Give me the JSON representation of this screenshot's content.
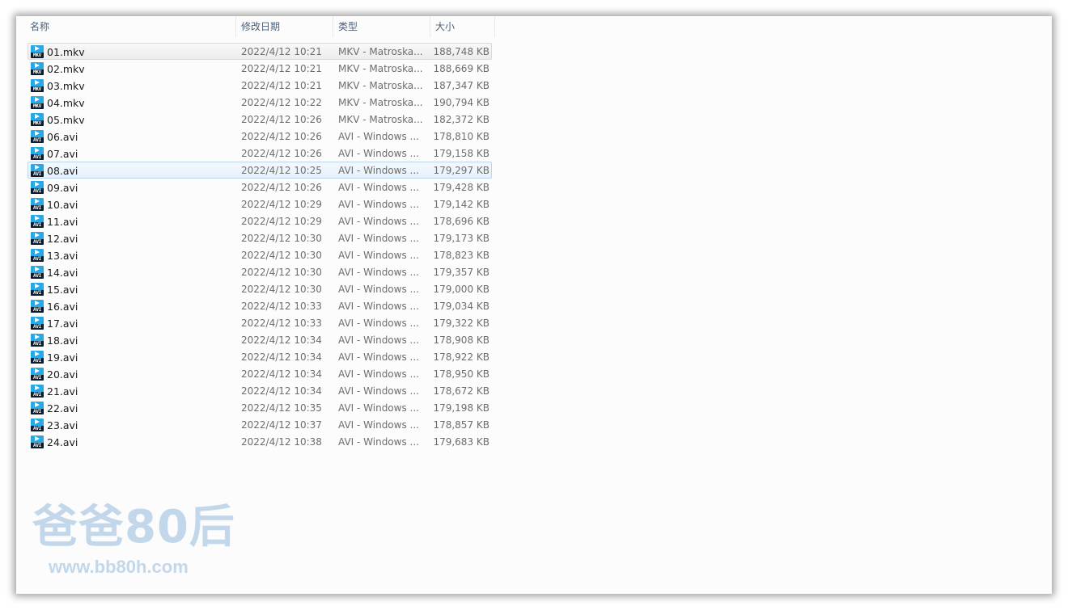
{
  "header": {
    "columns": {
      "name": "名称",
      "date": "修改日期",
      "type": "类型",
      "size": "大小"
    },
    "sort_indicator": "˄"
  },
  "files": [
    {
      "name": "01.mkv",
      "date": "2022/4/12 10:21",
      "type": "MKV - Matroska...",
      "size": "188,748 KB",
      "icon": "mkv-file-icon",
      "tag": "MKV"
    },
    {
      "name": "02.mkv",
      "date": "2022/4/12 10:21",
      "type": "MKV - Matroska...",
      "size": "188,669 KB",
      "icon": "mkv-file-icon",
      "tag": "MKV"
    },
    {
      "name": "03.mkv",
      "date": "2022/4/12 10:21",
      "type": "MKV - Matroska...",
      "size": "187,347 KB",
      "icon": "mkv-file-icon",
      "tag": "MKV"
    },
    {
      "name": "04.mkv",
      "date": "2022/4/12 10:22",
      "type": "MKV - Matroska...",
      "size": "190,794 KB",
      "icon": "mkv-file-icon",
      "tag": "MKV"
    },
    {
      "name": "05.mkv",
      "date": "2022/4/12 10:26",
      "type": "MKV - Matroska...",
      "size": "182,372 KB",
      "icon": "mkv-file-icon",
      "tag": "MKV"
    },
    {
      "name": "06.avi",
      "date": "2022/4/12 10:26",
      "type": "AVI - Windows ...",
      "size": "178,810 KB",
      "icon": "avi-file-icon",
      "tag": "AVI"
    },
    {
      "name": "07.avi",
      "date": "2022/4/12 10:26",
      "type": "AVI - Windows ...",
      "size": "179,158 KB",
      "icon": "avi-file-icon",
      "tag": "AVI"
    },
    {
      "name": "08.avi",
      "date": "2022/4/12 10:25",
      "type": "AVI - Windows ...",
      "size": "179,297 KB",
      "icon": "avi-file-icon",
      "tag": "AVI"
    },
    {
      "name": "09.avi",
      "date": "2022/4/12 10:26",
      "type": "AVI - Windows ...",
      "size": "179,428 KB",
      "icon": "avi-file-icon",
      "tag": "AVI"
    },
    {
      "name": "10.avi",
      "date": "2022/4/12 10:29",
      "type": "AVI - Windows ...",
      "size": "179,142 KB",
      "icon": "avi-file-icon",
      "tag": "AVI"
    },
    {
      "name": "11.avi",
      "date": "2022/4/12 10:29",
      "type": "AVI - Windows ...",
      "size": "178,696 KB",
      "icon": "avi-file-icon",
      "tag": "AVI"
    },
    {
      "name": "12.avi",
      "date": "2022/4/12 10:30",
      "type": "AVI - Windows ...",
      "size": "179,173 KB",
      "icon": "avi-file-icon",
      "tag": "AVI"
    },
    {
      "name": "13.avi",
      "date": "2022/4/12 10:30",
      "type": "AVI - Windows ...",
      "size": "178,823 KB",
      "icon": "avi-file-icon",
      "tag": "AVI"
    },
    {
      "name": "14.avi",
      "date": "2022/4/12 10:30",
      "type": "AVI - Windows ...",
      "size": "179,357 KB",
      "icon": "avi-file-icon",
      "tag": "AVI"
    },
    {
      "name": "15.avi",
      "date": "2022/4/12 10:30",
      "type": "AVI - Windows ...",
      "size": "179,000 KB",
      "icon": "avi-file-icon",
      "tag": "AVI"
    },
    {
      "name": "16.avi",
      "date": "2022/4/12 10:33",
      "type": "AVI - Windows ...",
      "size": "179,034 KB",
      "icon": "avi-file-icon",
      "tag": "AVI"
    },
    {
      "name": "17.avi",
      "date": "2022/4/12 10:33",
      "type": "AVI - Windows ...",
      "size": "179,322 KB",
      "icon": "avi-file-icon",
      "tag": "AVI"
    },
    {
      "name": "18.avi",
      "date": "2022/4/12 10:34",
      "type": "AVI - Windows ...",
      "size": "178,908 KB",
      "icon": "avi-file-icon",
      "tag": "AVI"
    },
    {
      "name": "19.avi",
      "date": "2022/4/12 10:34",
      "type": "AVI - Windows ...",
      "size": "178,922 KB",
      "icon": "avi-file-icon",
      "tag": "AVI"
    },
    {
      "name": "20.avi",
      "date": "2022/4/12 10:34",
      "type": "AVI - Windows ...",
      "size": "178,950 KB",
      "icon": "avi-file-icon",
      "tag": "AVI"
    },
    {
      "name": "21.avi",
      "date": "2022/4/12 10:34",
      "type": "AVI - Windows ...",
      "size": "178,672 KB",
      "icon": "avi-file-icon",
      "tag": "AVI"
    },
    {
      "name": "22.avi",
      "date": "2022/4/12 10:35",
      "type": "AVI - Windows ...",
      "size": "179,198 KB",
      "icon": "avi-file-icon",
      "tag": "AVI"
    },
    {
      "name": "23.avi",
      "date": "2022/4/12 10:37",
      "type": "AVI - Windows ...",
      "size": "178,857 KB",
      "icon": "avi-file-icon",
      "tag": "AVI"
    },
    {
      "name": "24.avi",
      "date": "2022/4/12 10:38",
      "type": "AVI - Windows ...",
      "size": "179,683 KB",
      "icon": "avi-file-icon",
      "tag": "AVI"
    }
  ],
  "selection": {
    "selected_index": 0,
    "hovered_index": 7
  },
  "watermark": {
    "title": "爸爸80后",
    "url": "www.bb80h.com"
  },
  "colors": {
    "icon_blue": "#27a9e7",
    "header_text": "#4c607a",
    "row_text": "#6d6d6d",
    "watermark": "#c3d7ea"
  }
}
